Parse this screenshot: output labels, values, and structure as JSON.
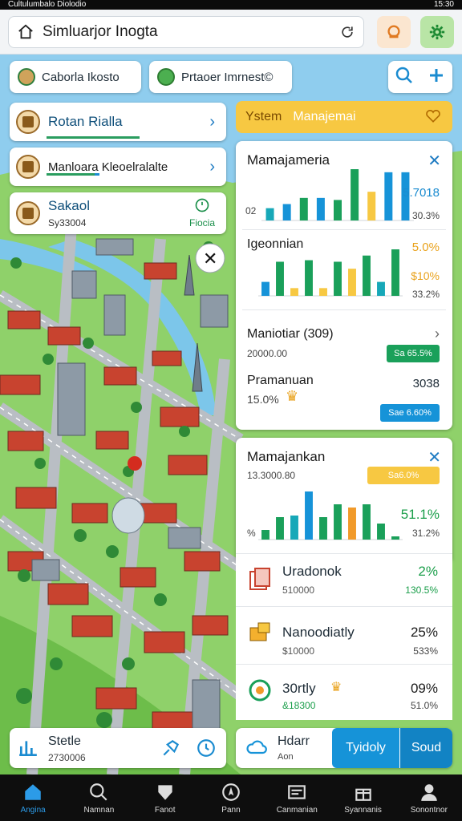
{
  "status_bar": {
    "left": "Cultulumbalo Diolodio",
    "time": "15:30"
  },
  "topbar": {
    "title": "Simluarjor Inogta"
  },
  "chips": [
    {
      "label": "Caborla Ikosto"
    },
    {
      "label": "Prtaoer Imrnest©"
    }
  ],
  "left_cards": [
    {
      "title": "Rotan Rialla"
    },
    {
      "title": "Manloara Kleoelralalte"
    },
    {
      "title": "Sakaol",
      "subtitle": "Sy33004",
      "action": "Fiocia"
    }
  ],
  "right_header": {
    "label": "Ystem",
    "label2": "Manajemai"
  },
  "panel1": {
    "title": "Mamajameria",
    "left_tick": "02",
    "value": "5.7018",
    "value2": "30.3%",
    "section2_title": "Igeonnian",
    "section2_pct": "5.0%",
    "section2_pct2": "$10%",
    "section2_pct3": "33.2%",
    "row1_title": "Maniotiar (309)",
    "row1_sub": "20000.00",
    "row1_badge": "Sa 65.5%",
    "row2_title": "Pramanuan",
    "row2_sub": "15.0%",
    "row2_val": "3038",
    "row2_badge": "Sae 6.60%"
  },
  "panel2": {
    "title": "Mamajankan",
    "sub": "13.3000.80",
    "badge": "Sa6.0%",
    "pct1": "51.1%",
    "pct2": "31.2%",
    "left_tick": "%"
  },
  "lower_rows": [
    {
      "name": "Uradonok",
      "sub": "510000",
      "v1": "2%",
      "v2": "130.5%"
    },
    {
      "name": "Nanoodiatly",
      "sub": "$10000",
      "v1": "25%",
      "v2": "533%"
    },
    {
      "name": "30rtly",
      "sub": "&18300",
      "v1": "09%",
      "v2": "51.0%"
    },
    {
      "name": "Hdarr",
      "sub": "Aon"
    }
  ],
  "bottom_card": {
    "title": "Stetle",
    "sub": "2730006"
  },
  "bottom_actions": {
    "btn1": "Tyidoly",
    "btn2": "Soud"
  },
  "nav": [
    {
      "label": "Angina"
    },
    {
      "label": "Namnan"
    },
    {
      "label": "Fanot"
    },
    {
      "label": "Pann"
    },
    {
      "label": "Canmanian"
    },
    {
      "label": "Syannanis"
    },
    {
      "label": "Sonontnor"
    }
  ],
  "chart_data": [
    {
      "type": "bar",
      "categories": [
        "1",
        "2",
        "3",
        "4",
        "5",
        "6",
        "7",
        "8",
        "9"
      ],
      "series": [
        {
          "values": [
            12,
            16,
            22,
            22,
            20,
            50,
            28,
            47,
            47
          ]
        }
      ]
    },
    {
      "type": "bar",
      "categories": [
        "1",
        "2",
        "3",
        "4",
        "5",
        "6",
        "7",
        "8",
        "9",
        "10"
      ],
      "series": [
        {
          "values": [
            18,
            44,
            10,
            46,
            10,
            44,
            35,
            52,
            18,
            60
          ]
        }
      ]
    },
    {
      "type": "bar",
      "categories": [
        "1",
        "2",
        "3",
        "4",
        "5",
        "6",
        "7",
        "8",
        "9",
        "10"
      ],
      "series": [
        {
          "values": [
            12,
            28,
            30,
            60,
            28,
            44,
            40,
            44,
            20,
            4
          ]
        }
      ]
    }
  ],
  "colors": {
    "green": "#1aa05a",
    "blue": "#1693d8",
    "yellow": "#f7c842",
    "orange": "#f19a2a"
  }
}
